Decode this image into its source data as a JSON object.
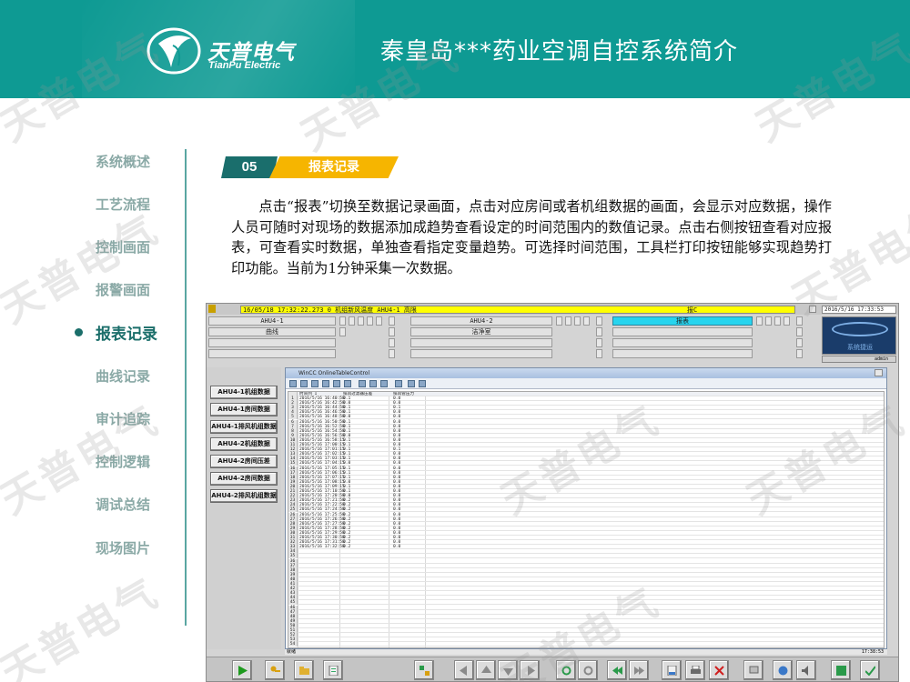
{
  "header": {
    "brand_cn": "天普电气",
    "brand_en": "TianPu Electric",
    "title": "秦皇岛***药业空调自控系统简介",
    "logo_icon": "tianpu-leaf-logo-icon",
    "bg_color": "#0e9a93"
  },
  "watermark": "天普电气",
  "nav": {
    "items": [
      {
        "label": "系统概述",
        "active": false
      },
      {
        "label": "工艺流程",
        "active": false
      },
      {
        "label": "控制画面",
        "active": false
      },
      {
        "label": "报警画面",
        "active": false
      },
      {
        "label": "报表记录",
        "active": true
      },
      {
        "label": "曲线记录",
        "active": false
      },
      {
        "label": "审计追踪",
        "active": false
      },
      {
        "label": "控制逻辑",
        "active": false
      },
      {
        "label": "调试总结",
        "active": false
      },
      {
        "label": "现场图片",
        "active": false
      }
    ],
    "active_color": "#1b6e6a",
    "inactive_color": "#8aa9a6"
  },
  "section": {
    "number": "05",
    "title": "报表记录",
    "number_color": "#1a6e6c",
    "title_color": "#f6b500"
  },
  "paragraph": "点击“报表”切换至数据记录画面，点击对应房间或者机组数据的画面，会显示对应数据，操作人员可随时对现场的数据添加成趋势查看设定的时间范围内的数值记录。点击右侧按钮查看对应报表，可查看实时数据，单独查看指定变量趋势。可选择时间范围，工具栏打印按钮能够实现趋势打印功能。当前为1分钟采集一次数据。",
  "screenshot": {
    "alarm_text": "16/05/18 17:32:22.273 0  机组新风温度_AHU4-1_高限",
    "alarm_count": "报C",
    "sys_time": "2016/5/16 17:33:53",
    "nav_rows": [
      [
        "AHU4-1",
        "AHU4-2",
        "报表"
      ],
      [
        "曲线",
        "洁净室",
        ""
      ],
      [
        "",
        "",
        ""
      ],
      [
        "",
        "",
        ""
      ]
    ],
    "brand_label": "系统捷运",
    "brand_small": "admin",
    "data_buttons": [
      "AHU4-1机组数据",
      "AHU4-1房间数据",
      "AHU4-1排风机组数据",
      "AHU4-2机组数据",
      "AHU4-2房间压差",
      "AHU4-2房间数据",
      "AHU4-2排风机组数据"
    ],
    "table_window_title": "WinCC OnlineTableControl",
    "table_headers": [
      "时间列 1",
      "排风过滤器压差",
      "排风管压力"
    ],
    "table_rows": [
      [
        "2016/5/16 16:40:58",
        "0.1",
        "0.0"
      ],
      [
        "2016/5/16 16:42:58",
        "0.0",
        "0.0"
      ],
      [
        "2016/5/16 16:44:58",
        "0.1",
        "0.1"
      ],
      [
        "2016/5/16 16:46:58",
        "0.1",
        "0.0"
      ],
      [
        "2016/5/16 16:48:58",
        "0.0",
        "0.0"
      ],
      [
        "2016/5/16 16:50:58",
        "0.1",
        "0.0"
      ],
      [
        "2016/5/16 16:52:58",
        "0.1",
        "0.0"
      ],
      [
        "2016/5/16 16:54:58",
        "0.1",
        "0.0"
      ],
      [
        "2016/5/16 16:56:58",
        "0.0",
        "0.0"
      ],
      [
        "2016/5/16 16:58:15",
        "0.1",
        "0.0"
      ],
      [
        "2016/5/16 17:00:15",
        "0.1",
        "0.0"
      ],
      [
        "2016/5/16 17:01:15",
        "0.1",
        "0.1"
      ],
      [
        "2016/5/16 17:02:15",
        "0.1",
        "0.0"
      ],
      [
        "2016/5/16 17:03:15",
        "0.1",
        "0.0"
      ],
      [
        "2016/5/16 17:04:15",
        "0.0",
        "0.0"
      ],
      [
        "2016/5/16 17:05:15",
        "0.1",
        "0.0"
      ],
      [
        "2016/5/16 17:06:15",
        "0.1",
        "0.0"
      ],
      [
        "2016/5/16 17:07:15",
        "0.1",
        "0.0"
      ],
      [
        "2016/5/16 17:08:15",
        "0.0",
        "0.0"
      ],
      [
        "2016/5/16 17:09:15",
        "0.1",
        "0.0"
      ],
      [
        "2016/5/16 17:10:58",
        "0.1",
        "0.0"
      ],
      [
        "2016/5/16 17:20:58",
        "0.0",
        "0.0"
      ],
      [
        "2016/5/16 17:21:58",
        "0.2",
        "0.0"
      ],
      [
        "2016/5/16 17:22:58",
        "0.2",
        "0.0"
      ],
      [
        "2016/5/16 17:24:58",
        "0.2",
        "0.0"
      ],
      [
        "2016/5/16 17:25:58",
        "0.2",
        "0.0"
      ],
      [
        "2016/5/16 17:26:58",
        "0.2",
        "0.0"
      ],
      [
        "2016/5/16 17:27:58",
        "0.2",
        "0.0"
      ],
      [
        "2016/5/16 17:28:58",
        "0.2",
        "0.0"
      ],
      [
        "2016/5/16 17:29:58",
        "0.2",
        "0.0"
      ],
      [
        "2016/5/16 17:30:58",
        "0.2",
        "0.0"
      ],
      [
        "2016/5/16 17:31:58",
        "0.2",
        "0.0"
      ],
      [
        "2016/5/16 17:32:58",
        "0.2",
        "0.0"
      ]
    ],
    "status_left": "就绪",
    "status_right": "17:38:53"
  }
}
